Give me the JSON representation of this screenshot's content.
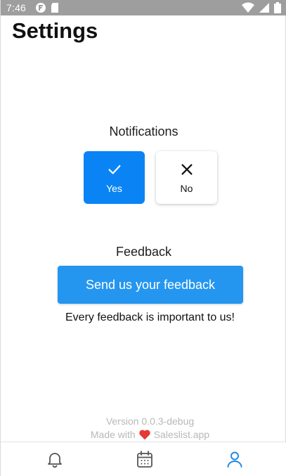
{
  "status_bar": {
    "time": "7:46",
    "icons": [
      "app-notification-icon",
      "sd-card-icon",
      "wifi-icon",
      "signal-icon",
      "battery-icon"
    ]
  },
  "page": {
    "title": "Settings"
  },
  "notifications": {
    "label": "Notifications",
    "options": [
      {
        "label": "Yes",
        "icon": "check-icon",
        "selected": true
      },
      {
        "label": "No",
        "icon": "close-icon",
        "selected": false
      }
    ]
  },
  "feedback": {
    "label": "Feedback",
    "button_label": "Send us your feedback",
    "note": "Every feedback is important to us!"
  },
  "footer": {
    "version": "Version 0.0.3-debug",
    "made_with_prefix": "Made with",
    "made_with_suffix": "Saleslist.app"
  },
  "bottom_nav": {
    "items": [
      {
        "icon": "bell-icon",
        "active": false
      },
      {
        "icon": "calendar-icon",
        "active": false
      },
      {
        "icon": "user-icon",
        "active": true
      }
    ]
  },
  "colors": {
    "accent": "#0a84f5",
    "button_blue": "#2496f0",
    "status_bar": "#9e9e9e",
    "muted_text": "#b8b8b8",
    "heart": "#e53935"
  }
}
